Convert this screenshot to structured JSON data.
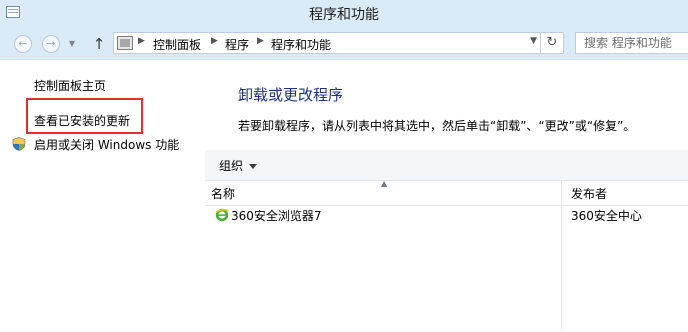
{
  "window": {
    "title": "程序和功能",
    "app_icon": "control-panel-window-icon"
  },
  "nav": {
    "back_icon": "back-arrow-icon",
    "forward_icon": "forward-arrow-icon",
    "up_icon": "up-arrow-icon",
    "up_glyph": "↑",
    "back_glyph": "←",
    "forward_glyph": "→",
    "dropdown_glyph": "▼",
    "refresh_glyph": "↻",
    "sep_glyph": "▶",
    "breadcrumbs": [
      "控制面板",
      "程序",
      "程序和功能"
    ],
    "search_placeholder": "搜索 程序和功能"
  },
  "sidebar": {
    "items": [
      {
        "label": "控制面板主页"
      },
      {
        "label": "查看已安装的更新",
        "highlighted": true,
        "highlight_color": "#e53030"
      },
      {
        "label": "启用或关闭 Windows 功能",
        "icon": "uac-shield-icon"
      }
    ]
  },
  "main": {
    "title": "卸载或更改程序",
    "description": "若要卸载程序，请从列表中将其选中，然后单击“卸载”、“更改”或“修复”。",
    "toolbar": {
      "organize_label": "组织"
    },
    "columns": {
      "name": "名称",
      "publisher": "发布者",
      "sort_glyph": "▲"
    },
    "programs": [
      {
        "name": "360安全浏览器7",
        "publisher": "360安全中心",
        "icon": "360-browser-icon"
      }
    ]
  },
  "colors": {
    "title_blue": "#1e3287",
    "chrome_bg": "#dbeaf7",
    "highlight": "#e53030"
  }
}
